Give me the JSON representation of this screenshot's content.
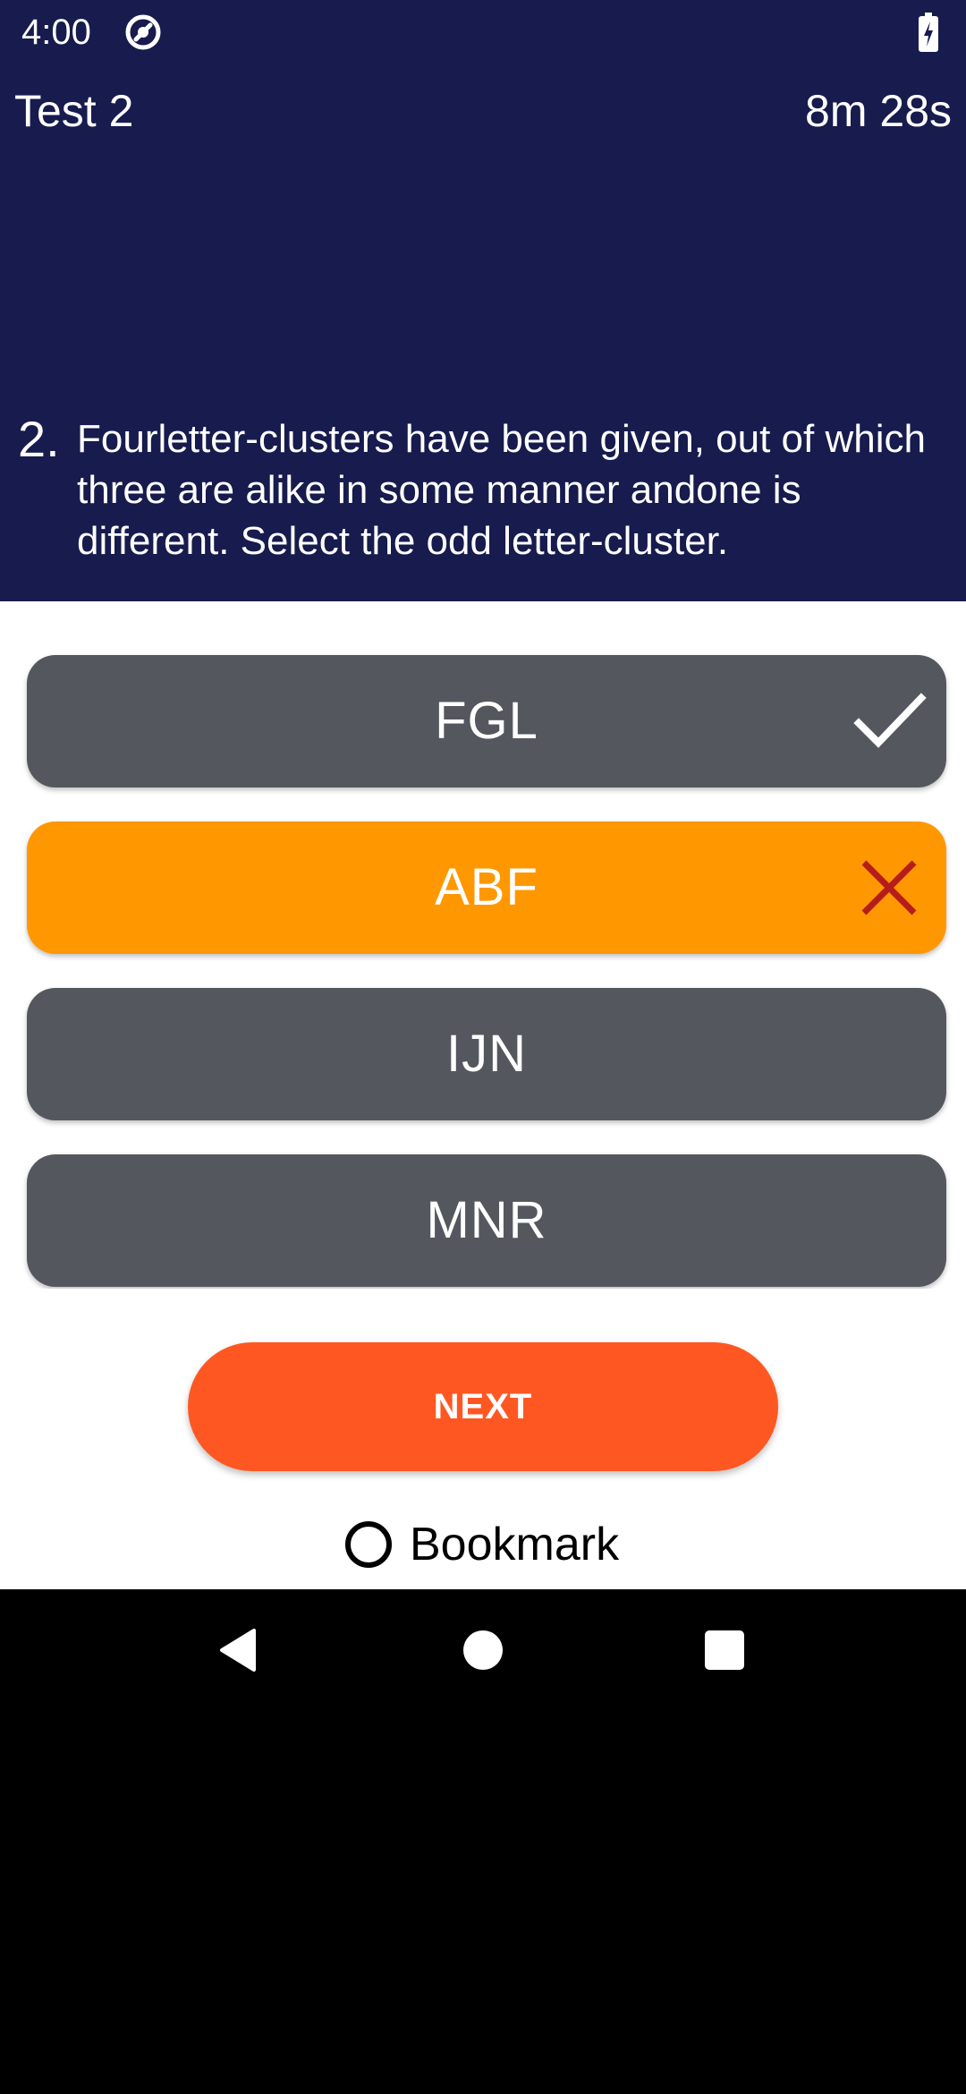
{
  "status_bar": {
    "time": "4:00",
    "icons": [
      "sync-status-icon",
      "battery-charging-icon"
    ]
  },
  "header": {
    "title": "Test 2",
    "timer": "8m 28s"
  },
  "question": {
    "number": "2.",
    "text": "Fourletter-clusters have been given, out of which three are alike in some manner andone is different. Select the odd letter-cluster."
  },
  "options": [
    {
      "label": "FGL",
      "state": "correct",
      "mark_icon": "check-icon"
    },
    {
      "label": "ABF",
      "state": "selected-wrong",
      "mark_icon": "cross-icon"
    },
    {
      "label": "IJN",
      "state": "default"
    },
    {
      "label": "MNR",
      "state": "default"
    }
  ],
  "actions": {
    "next_label": "NEXT",
    "bookmark_label": "Bookmark",
    "bookmark_checked": false
  },
  "nav_bar": {
    "icons": [
      "back-icon",
      "home-icon",
      "recents-icon"
    ]
  },
  "colors": {
    "header_bg": "#171b4d",
    "option_default": "#54575e",
    "option_selected_wrong": "#ff9800",
    "next_button": "#ff5722",
    "wrong_mark": "#b71c1c"
  }
}
